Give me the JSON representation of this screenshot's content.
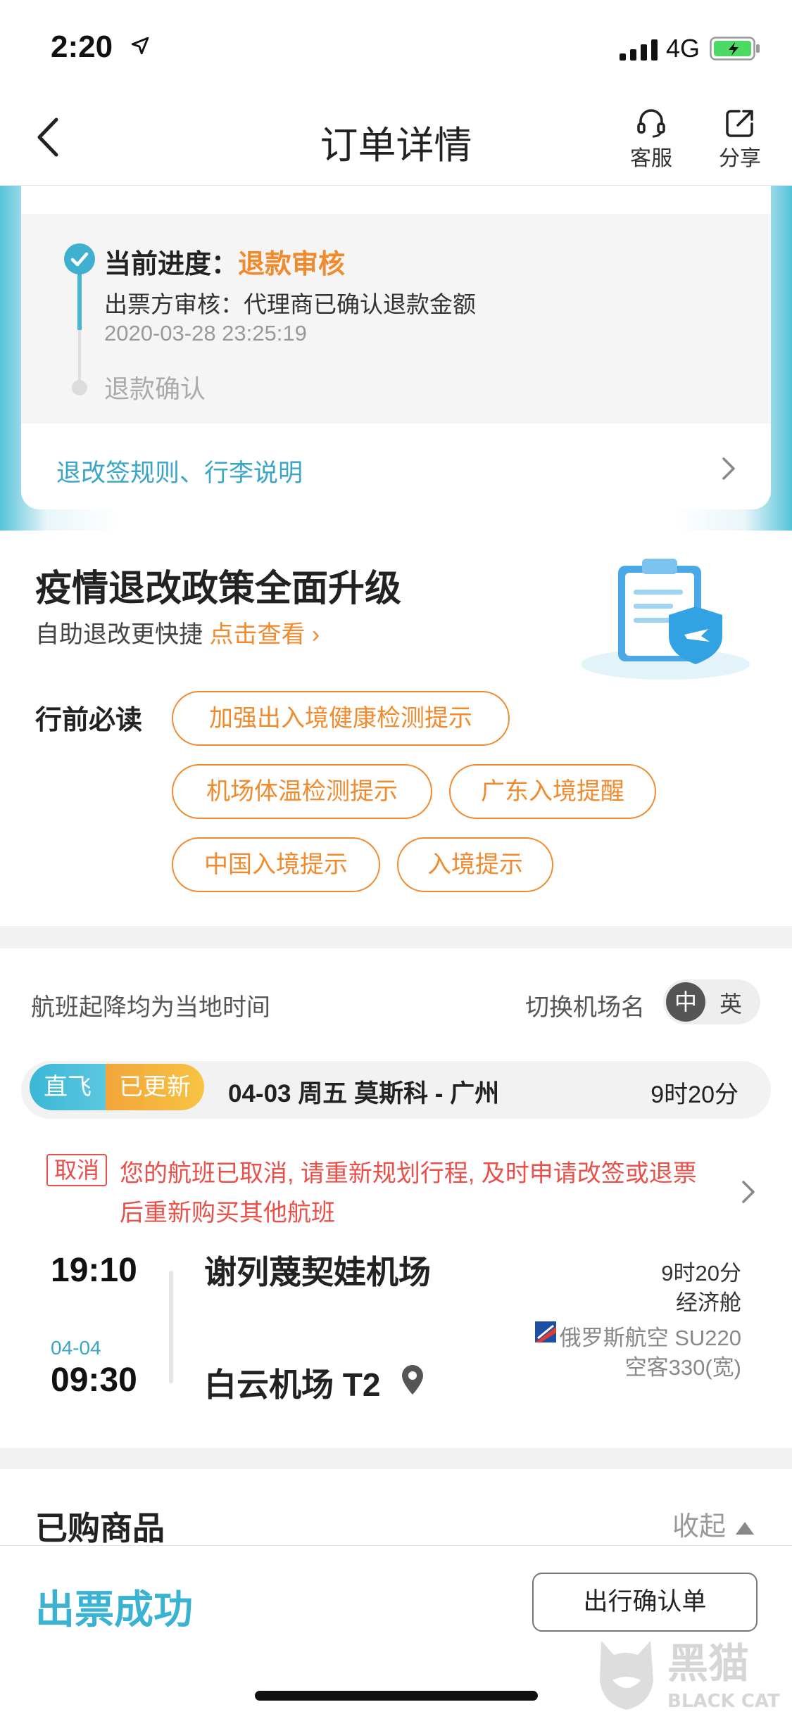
{
  "status_bar": {
    "time": "2:20",
    "network": "4G"
  },
  "nav": {
    "title": "订单详情",
    "service_label": "客服",
    "share_label": "分享"
  },
  "progress": {
    "label": "当前进度：",
    "status": "退款审核",
    "detail": "出票方审核：代理商已确认退款金额",
    "timestamp": "2020-03-28 23:25:19",
    "next_step": "退款确认"
  },
  "rules_link": "退改签规则、行李说明",
  "policy": {
    "title": "疫情退改政策全面升级",
    "subtitle": "自助退改更快捷",
    "link": "点击查看",
    "link_arrow": "›",
    "tips_label": "行前必读",
    "chips": [
      "加强出入境健康检测提示",
      "机场体温检测提示",
      "广东入境提醒",
      "中国入境提示",
      "入境提示"
    ]
  },
  "flight": {
    "local_time_note": "航班起降均为当地时间",
    "switch_label": "切换机场名",
    "lang_zh": "中",
    "lang_en": "英",
    "badge_direct": "直飞",
    "badge_updated": "已更新",
    "route_info": "04-03  周五  莫斯科 - 广州",
    "route_duration": "9时20分",
    "cancel_tag": "取消",
    "cancel_message": "您的航班已取消, 请重新规划行程, 及时申请改签或退票后重新购买其他航班",
    "departure_time": "19:10",
    "departure_airport": "谢列蔑契娃机场",
    "arrival_date": "04-04",
    "arrival_time": "09:30",
    "arrival_airport": "白云机场 T2",
    "duration": "9时20分",
    "cabin": "经济舱",
    "airline": "俄罗斯航空 SU220",
    "aircraft": "空客330(宽)"
  },
  "goods": {
    "title": "已购商品",
    "collapse_label": "收起"
  },
  "bottom": {
    "ticket_status": "出票成功",
    "confirm_button": "出行确认单"
  },
  "watermark": {
    "text_cn": "黑猫",
    "text_en": "BLACK CAT"
  },
  "colors": {
    "accent_blue": "#3ab2d2",
    "accent_orange": "#f08a2c",
    "alert_red": "#e8504a"
  }
}
